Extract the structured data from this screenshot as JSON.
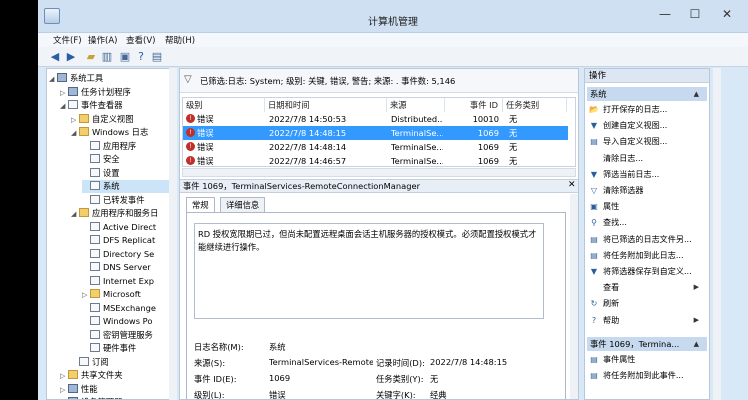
{
  "window": {
    "title": "计算机管理"
  },
  "menu": [
    "文件(F)",
    "操作(A)",
    "查看(V)",
    "帮助(H)"
  ],
  "tree": [
    {
      "label": "系统工具",
      "level": 0,
      "arrow": "◢",
      "icon": "pc"
    },
    {
      "label": "任务计划程序",
      "level": 1,
      "arrow": "▷",
      "icon": "pc"
    },
    {
      "label": "事件查看器",
      "level": 1,
      "arrow": "◢",
      "icon": "log"
    },
    {
      "label": "自定义视图",
      "level": 2,
      "arrow": "▷",
      "icon": "folder"
    },
    {
      "label": "Windows 日志",
      "level": 2,
      "arrow": "◢",
      "icon": "folder"
    },
    {
      "label": "应用程序",
      "level": 3,
      "arrow": "",
      "icon": "log"
    },
    {
      "label": "安全",
      "level": 3,
      "arrow": "",
      "icon": "log"
    },
    {
      "label": "设置",
      "level": 3,
      "arrow": "",
      "icon": "log"
    },
    {
      "label": "系统",
      "level": 3,
      "arrow": "",
      "icon": "log",
      "selected": true
    },
    {
      "label": "已转发事件",
      "level": 3,
      "arrow": "",
      "icon": "log"
    },
    {
      "label": "应用程序和服务日",
      "level": 2,
      "arrow": "◢",
      "icon": "folder"
    },
    {
      "label": "Active Direct",
      "level": 3,
      "arrow": "",
      "icon": "log"
    },
    {
      "label": "DFS Replicat",
      "level": 3,
      "arrow": "",
      "icon": "log"
    },
    {
      "label": "Directory Se",
      "level": 3,
      "arrow": "",
      "icon": "log"
    },
    {
      "label": "DNS Server",
      "level": 3,
      "arrow": "",
      "icon": "log"
    },
    {
      "label": "Internet Exp",
      "level": 3,
      "arrow": "",
      "icon": "log"
    },
    {
      "label": "Microsoft",
      "level": 3,
      "arrow": "▷",
      "icon": "folder"
    },
    {
      "label": "MSExchange",
      "level": 3,
      "arrow": "",
      "icon": "log"
    },
    {
      "label": "Windows Po",
      "level": 3,
      "arrow": "",
      "icon": "log"
    },
    {
      "label": "密钥管理服务",
      "level": 3,
      "arrow": "",
      "icon": "log"
    },
    {
      "label": "硬件事件",
      "level": 3,
      "arrow": "",
      "icon": "log"
    },
    {
      "label": "订阅",
      "level": 2,
      "arrow": "",
      "icon": "log"
    },
    {
      "label": "共享文件夹",
      "level": 1,
      "arrow": "▷",
      "icon": "folder"
    },
    {
      "label": "性能",
      "level": 1,
      "arrow": "▷",
      "icon": "pc"
    },
    {
      "label": "设备管理器",
      "level": 1,
      "arrow": "",
      "icon": "pc"
    }
  ],
  "filter_text": "已筛选:日志: System; 级别: 关键, 错误, 警告; 来源: . 事件数: 5,146",
  "grid": {
    "headers": [
      "级别",
      "日期和时间",
      "来源",
      "事件 ID",
      "任务类别"
    ],
    "rows": [
      {
        "level": "错误",
        "datetime": "2022/7/8 14:50:53",
        "source": "Distributed...",
        "event_id": "10010",
        "category": "无",
        "selected": false
      },
      {
        "level": "错误",
        "datetime": "2022/7/8 14:48:15",
        "source": "TerminalSe...",
        "event_id": "1069",
        "category": "无",
        "selected": true
      },
      {
        "level": "错误",
        "datetime": "2022/7/8 14:48:14",
        "source": "TerminalSe...",
        "event_id": "1069",
        "category": "无",
        "selected": false
      },
      {
        "level": "错误",
        "datetime": "2022/7/8 14:46:57",
        "source": "TerminalSe...",
        "event_id": "1069",
        "category": "无",
        "selected": false
      }
    ]
  },
  "detail": {
    "title": "事件 1069，TerminalServices-RemoteConnectionManager",
    "tabs": [
      "常规",
      "详细信息"
    ],
    "description": "RD 授权宽限期已过，但尚未配置远程桌面会话主机服务器的授权模式。必须配置授权模式才能继续进行操作。",
    "props": {
      "log_name_label": "日志名称(M):",
      "log_name": "系统",
      "source_label": "来源(S):",
      "source": "TerminalServices-Remote",
      "logged_label": "记录时间(D):",
      "logged": "2022/7/8 14:48:15",
      "event_id_label": "事件 ID(E):",
      "event_id": "1069",
      "task_label": "任务类别(Y):",
      "task": "无",
      "level_label": "级别(L):",
      "level": "错误",
      "keywords_label": "关键字(K):",
      "keywords": "经典"
    }
  },
  "actions": {
    "header": "操作",
    "section1": "系统",
    "items1": [
      {
        "label": "打开保存的日志...",
        "icon": "open-icon",
        "glyph": "📂"
      },
      {
        "label": "创建自定义视图...",
        "icon": "filter-add-icon",
        "glyph": "▼"
      },
      {
        "label": "导入自定义视图...",
        "icon": "import-icon",
        "glyph": "▤"
      },
      {
        "label": "清除日志...",
        "icon": "clear-icon",
        "glyph": ""
      },
      {
        "label": "筛选当前日志...",
        "icon": "filter-icon",
        "glyph": "▼"
      },
      {
        "label": "清除筛选器",
        "icon": "clear-filter-icon",
        "glyph": "▽"
      },
      {
        "label": "属性",
        "icon": "properties-icon",
        "glyph": "▣"
      },
      {
        "label": "查找...",
        "icon": "find-icon",
        "glyph": "⚲"
      },
      {
        "label": "将已筛选的日志文件另...",
        "icon": "save-icon",
        "glyph": "▤"
      },
      {
        "label": "将任务附加到此日志...",
        "icon": "task-icon",
        "glyph": "▤"
      },
      {
        "label": "将筛选器保存到自定义...",
        "icon": "save-filter-icon",
        "glyph": "▼"
      },
      {
        "label": "查看",
        "icon": "view-icon",
        "glyph": "",
        "submenu": true
      },
      {
        "label": "刷新",
        "icon": "refresh-icon",
        "glyph": "↻"
      },
      {
        "label": "帮助",
        "icon": "help-icon",
        "glyph": "?",
        "submenu": true
      }
    ],
    "section2": "事件 1069，Termina...",
    "items2": [
      {
        "label": "事件属性",
        "icon": "event-properties-icon",
        "glyph": "▤"
      },
      {
        "label": "将任务附加到此事件...",
        "icon": "attach-task-icon",
        "glyph": "▤"
      }
    ]
  }
}
